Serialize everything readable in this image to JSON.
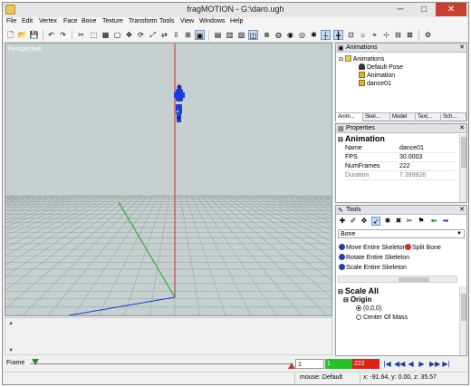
{
  "window": {
    "title": "fragMOTION - G:\\daro.ugh",
    "min_glyph": "─",
    "max_glyph": "□",
    "close_glyph": "✕"
  },
  "menu": [
    "File",
    "Edit",
    "Vertex",
    "Face",
    "Bone",
    "Texture",
    "Transform",
    "Tools",
    "View",
    "Windows",
    "Help"
  ],
  "viewport": {
    "label": "Perspective"
  },
  "animations_panel": {
    "title": "Animations",
    "tree": [
      {
        "label": "Animations",
        "level": 0
      },
      {
        "label": "Default Pose",
        "level": 1
      },
      {
        "label": "Animation",
        "level": 1
      },
      {
        "label": "dance01",
        "level": 1
      }
    ],
    "tabs": [
      "Anim...",
      "Skel...",
      "Model",
      "Text...",
      "Sch..."
    ]
  },
  "properties_panel": {
    "title": "Properties",
    "section": "Animation",
    "rows": [
      {
        "key": "Name",
        "value": "dance01"
      },
      {
        "key": "FPS",
        "value": "30.0003"
      },
      {
        "key": "NumFrames",
        "value": "222"
      },
      {
        "key": "Duration",
        "value": "7.399926"
      }
    ]
  },
  "tools_panel": {
    "title": "Tools",
    "mode": "Bone",
    "actions": [
      "Move Entire Skeleton",
      "Split Bone",
      "Rotate Entire Skeleton",
      "Scale Entire Skeleton"
    ],
    "scale_title": "Scale All",
    "origin_label": "Origin",
    "origin_options": [
      "(0,0,0)",
      "Center Of Mass"
    ],
    "selected_origin": "(0,0,0)"
  },
  "timeline": {
    "label": "Frame",
    "current_frame": "1",
    "start_frame": "1",
    "end_frame": "222",
    "current_fraction": 0.0,
    "buttons": [
      "|◀",
      "◀◀",
      "◀",
      "▶",
      "▶▶",
      "▶|"
    ]
  },
  "status": {
    "mode": "mouse: Default",
    "coords": "x: -91.64, y: 0.00, z: 35.57"
  }
}
